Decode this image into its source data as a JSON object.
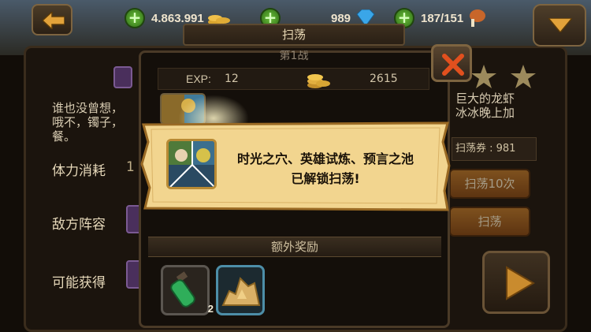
{
  "hud": {
    "gold": "4.863.991",
    "gems": "989",
    "stamina": "187/151",
    "back_icon": "back-arrow-icon",
    "menu_icon": "chevron-down-icon"
  },
  "title_tab": "扫荡",
  "background": {
    "story_text_left_1": "谁也没曾想，",
    "story_text_left_2": "哦不，镯子，",
    "story_text_left_3": "餐。",
    "story_text_right_1": "巨大的龙虾",
    "story_text_right_2": "冰冰晚上加",
    "stamina_cost_label": "体力消耗",
    "stamina_cost_value": "1",
    "enemy_label": "敌方阵容",
    "drops_label": "可能获得",
    "sweep_ticket": "扫荡券 : 981",
    "sweep10_label": "扫荡10次",
    "sweep_label": "扫荡",
    "stars": 3
  },
  "popup": {
    "header": "第1战",
    "exp_label": "EXP:",
    "exp_value": "12",
    "gold_value": "2615",
    "extra_rewards_label": "额外奖励",
    "rewards": [
      {
        "name": "green-potion",
        "count": "2"
      },
      {
        "name": "gold-ore",
        "count": ""
      }
    ]
  },
  "banner": {
    "line1": "时光之穴、英雄试炼、预言之池",
    "line2": "已解锁扫荡!"
  },
  "colors": {
    "parchment": "#f2d58f",
    "frame": "#4a3a27",
    "accent_green": "#4ea82a",
    "close_red": "#c4391c"
  }
}
